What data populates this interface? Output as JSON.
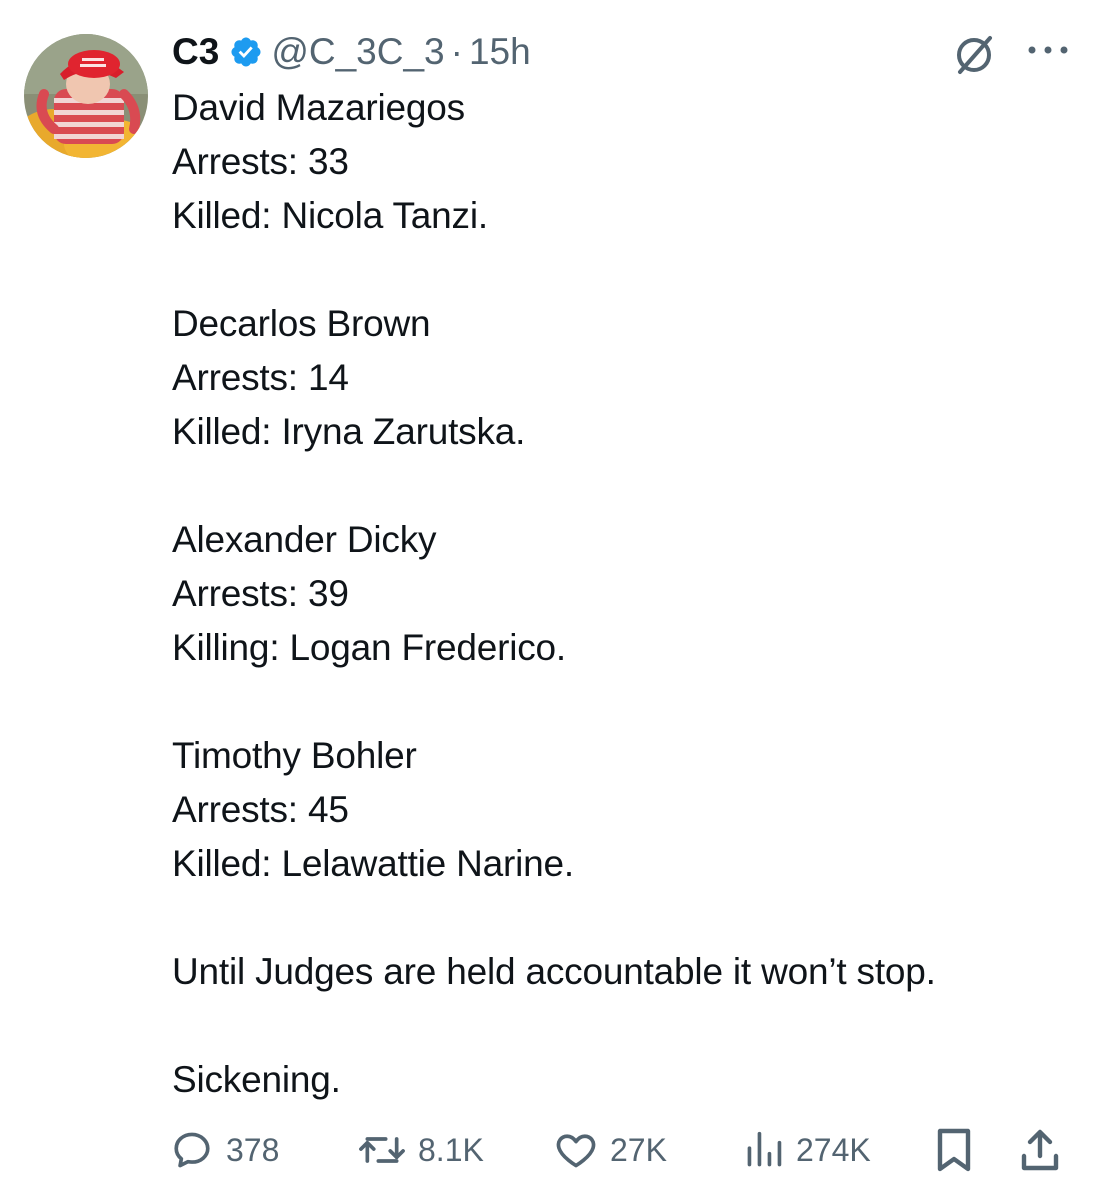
{
  "tweet": {
    "author": {
      "display_name": "C3",
      "handle": "@C_3C_3",
      "verified": true,
      "avatar_icon": "avatar-photo"
    },
    "time": "15h",
    "separator": "·",
    "lines": [
      "David Mazariegos",
      "Arrests: 33",
      "Killed: Nicola Tanzi.",
      "Decarlos Brown",
      "Arrests: 14",
      "Killed: Iryna Zarutska.",
      "Alexander Dicky",
      "Arrests: 39",
      "Killing: Logan Frederico.",
      "Timothy Bohler",
      "Arrests: 45",
      "Killed: Lelawattie Narine.",
      "Until Judges are held accountable it won’t stop.",
      "Sickening."
    ],
    "actions": {
      "replies": "378",
      "reposts": "8.1K",
      "likes": "27K",
      "views": "274K"
    }
  },
  "colors": {
    "text": "#0f1419",
    "muted": "#536471",
    "verified": "#1d9bf0"
  },
  "icons": {
    "grok": "grok-icon",
    "more": "more-icon",
    "reply": "reply-icon",
    "repost": "repost-icon",
    "like": "heart-icon",
    "views": "views-icon",
    "bookmark": "bookmark-icon",
    "share": "share-icon"
  }
}
